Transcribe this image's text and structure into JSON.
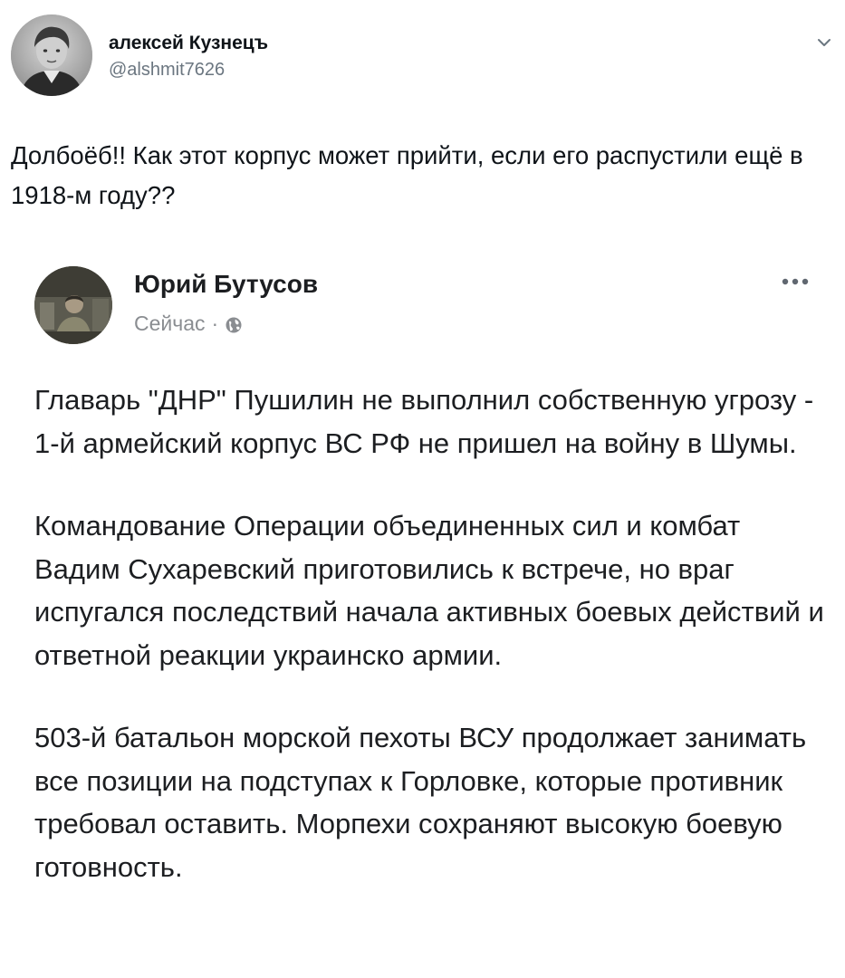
{
  "tweet": {
    "author_name": "алексей Кузнецъ",
    "author_handle": "@alshmit7626",
    "text": "Долбоёб!! Как этот корпус может прийти, если его распустили ещё в 1918-м году??"
  },
  "embedded_post": {
    "author_name": "Юрий Бутусов",
    "timestamp": "Сейчас",
    "separator": "·",
    "visibility_icon": "globe-icon",
    "paragraphs": [
      "Главарь \"ДНР\" Пушилин не выполнил собственную угрозу - 1-й армейский корпус ВС РФ не  пришел на войну в Шумы.",
      "Командование Операции объединенных сил и комбат Вадим Сухаревский приготовились к встрече, но враг испугался последствий начала активных боевых действий и ответной реакции украинско армии.",
      "503-й батальон морской пехоты ВСУ продолжает занимать все позиции на подступах к Горловке, которые противник требовал оставить. Морпехи сохраняют высокую боевую готовность."
    ]
  },
  "colors": {
    "text_primary": "#0f1419",
    "text_secondary": "#6b7680",
    "fb_text": "#1c1e21",
    "fb_meta": "#8a8d91"
  }
}
